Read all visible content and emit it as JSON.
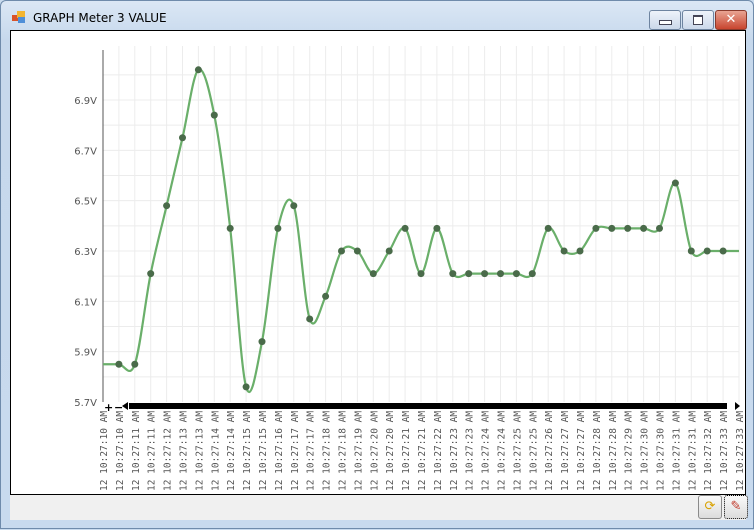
{
  "window": {
    "title": "GRAPH Meter 3 VALUE",
    "buttons": [
      "minimize",
      "maximize",
      "close"
    ]
  },
  "toolbar": {
    "icons": [
      "refresh-icon",
      "settings-tool-icon"
    ]
  },
  "chart_data": {
    "type": "line",
    "title": "",
    "xlabel": "",
    "ylabel": "",
    "ylim": [
      5.7,
      7.09
    ],
    "yticks": [
      "5.7V",
      "5.9V",
      "6.1V",
      "6.3V",
      "6.5V",
      "6.7V",
      "6.9V"
    ],
    "ytick_values": [
      5.7,
      5.9,
      6.1,
      6.3,
      6.5,
      6.7,
      6.9
    ],
    "grid": true,
    "smooth": true,
    "line_color": "#6aaf6a",
    "marker_color": "#4a6b4a",
    "categories": [
      "12 10:27:10 AM",
      "12 10:27:10 AM",
      "12 10:27:11 AM",
      "12 10:27:11 AM",
      "12 10:27:12 AM",
      "12 10:27:13 AM",
      "12 10:27:13 AM",
      "12 10:27:14 AM",
      "12 10:27:14 AM",
      "12 10:27:15 AM",
      "12 10:27:15 AM",
      "12 10:27:16 AM",
      "12 10:27:17 AM",
      "12 10:27:17 AM",
      "12 10:27:18 AM",
      "12 10:27:18 AM",
      "12 10:27:19 AM",
      "12 10:27:20 AM",
      "12 10:27:20 AM",
      "12 10:27:21 AM",
      "12 10:27:21 AM",
      "12 10:27:22 AM",
      "12 10:27:23 AM",
      "12 10:27:23 AM",
      "12 10:27:24 AM",
      "12 10:27:24 AM",
      "12 10:27:25 AM",
      "12 10:27:25 AM",
      "12 10:27:26 AM",
      "12 10:27:27 AM",
      "12 10:27:27 AM",
      "12 10:27:28 AM",
      "12 10:27:28 AM",
      "12 10:27:29 AM",
      "12 10:27:30 AM",
      "12 10:27:30 AM",
      "12 10:27:31 AM",
      "12 10:27:31 AM",
      "12 10:27:32 AM",
      "12 10:27:33 AM",
      "12 10:27:33 AM"
    ],
    "values": [
      5.85,
      5.85,
      5.85,
      6.21,
      6.48,
      6.75,
      7.02,
      6.84,
      6.39,
      5.76,
      5.94,
      6.39,
      6.48,
      6.03,
      6.12,
      6.3,
      6.3,
      6.21,
      6.3,
      6.39,
      6.21,
      6.39,
      6.21,
      6.21,
      6.21,
      6.21,
      6.21,
      6.21,
      6.39,
      6.3,
      6.3,
      6.39,
      6.39,
      6.39,
      6.39,
      6.39,
      6.57,
      6.3,
      6.3,
      6.3,
      6.3
    ]
  }
}
